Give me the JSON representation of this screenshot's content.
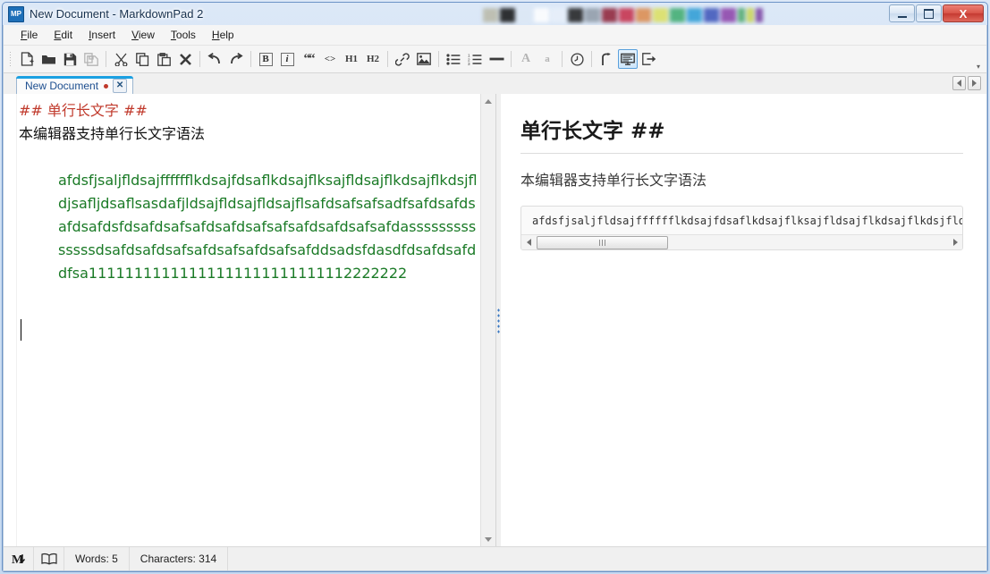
{
  "window": {
    "title": "New Document - MarkdownPad 2",
    "app_icon_label": "MP",
    "buttons": {
      "minimize": "Minimize",
      "maximize": "Maximize",
      "close": "X"
    }
  },
  "menubar": {
    "items": [
      {
        "label": "File",
        "accel": "F"
      },
      {
        "label": "Edit",
        "accel": "E"
      },
      {
        "label": "Insert",
        "accel": "I"
      },
      {
        "label": "View",
        "accel": "V"
      },
      {
        "label": "Tools",
        "accel": "T"
      },
      {
        "label": "Help",
        "accel": "H"
      }
    ]
  },
  "toolbar": {
    "items": [
      {
        "name": "new-document-icon",
        "label": "New",
        "kind": "icon"
      },
      {
        "name": "open-folder-icon",
        "label": "Open",
        "kind": "icon"
      },
      {
        "name": "save-icon",
        "label": "Save",
        "kind": "icon"
      },
      {
        "name": "save-all-icon",
        "label": "Save All",
        "kind": "icon",
        "dim": true
      },
      {
        "name": "separator",
        "label": "",
        "kind": "sep"
      },
      {
        "name": "cut-scissors-icon",
        "label": "Cut",
        "kind": "icon"
      },
      {
        "name": "copy-icon",
        "label": "Copy",
        "kind": "icon"
      },
      {
        "name": "paste-icon",
        "label": "Paste",
        "kind": "icon"
      },
      {
        "name": "delete-x-icon",
        "label": "Delete",
        "kind": "icon"
      },
      {
        "name": "separator",
        "label": "",
        "kind": "sep"
      },
      {
        "name": "undo-icon",
        "label": "Undo",
        "kind": "icon"
      },
      {
        "name": "redo-icon",
        "label": "Redo",
        "kind": "icon"
      },
      {
        "name": "separator",
        "label": "",
        "kind": "sep"
      },
      {
        "name": "bold-icon",
        "label": "B",
        "kind": "boxed"
      },
      {
        "name": "italic-icon",
        "label": "i",
        "kind": "boxed"
      },
      {
        "name": "blockquote-icon",
        "label": "““",
        "kind": "text"
      },
      {
        "name": "inline-code-icon",
        "label": "<>",
        "kind": "text"
      },
      {
        "name": "heading-1-icon",
        "label": "H1",
        "kind": "text"
      },
      {
        "name": "heading-2-icon",
        "label": "H2",
        "kind": "text"
      },
      {
        "name": "separator",
        "label": "",
        "kind": "sep"
      },
      {
        "name": "link-icon",
        "label": "Link",
        "kind": "icon"
      },
      {
        "name": "image-icon",
        "label": "Image",
        "kind": "icon"
      },
      {
        "name": "separator",
        "label": "",
        "kind": "sep"
      },
      {
        "name": "bulleted-list-icon",
        "label": "Bullets",
        "kind": "icon"
      },
      {
        "name": "numbered-list-icon",
        "label": "Numbering",
        "kind": "icon"
      },
      {
        "name": "horizontal-rule-icon",
        "label": "Rule",
        "kind": "icon"
      },
      {
        "name": "separator",
        "label": "",
        "kind": "sep"
      },
      {
        "name": "increase-font-icon",
        "label": "A",
        "kind": "text",
        "dim": true
      },
      {
        "name": "decrease-font-icon",
        "label": "a",
        "kind": "text",
        "dim": true
      },
      {
        "name": "separator",
        "label": "",
        "kind": "sep"
      },
      {
        "name": "timestamp-clock-icon",
        "label": "Timestamp",
        "kind": "icon"
      },
      {
        "name": "separator",
        "label": "",
        "kind": "sep"
      },
      {
        "name": "line-break-icon",
        "label": "Line Break",
        "kind": "icon"
      },
      {
        "name": "live-preview-icon",
        "label": "Live Preview",
        "kind": "icon",
        "selected": true
      },
      {
        "name": "export-icon",
        "label": "Export",
        "kind": "icon"
      }
    ],
    "overflow_label": "▾"
  },
  "tabs": {
    "items": [
      {
        "label": "New Document",
        "modified": true,
        "close_label": "✕"
      }
    ],
    "nav_prev_label": "◄",
    "nav_next_label": "►"
  },
  "editor": {
    "lines": [
      {
        "style": "heading",
        "text": "## 单行长文字 ##"
      },
      {
        "style": "paragraph",
        "text": "本编辑器支持单行长文字语法"
      },
      {
        "style": "blank",
        "text": ""
      },
      {
        "style": "code",
        "text": "afdsfjsaljfldsajfffffflkdsajfdsaflkdsajflksajfldsajflkdsajflkdsjfldjsafljdsaflsasdafjldsajfldsajfldsajflsafdsafsafsadfsafdsafdsafdsafdsfdsafdsafsafdsafdsafsafsafdsafdsafsafdassssssssssssssdsafdsafdsafsafdsafsafdsafsafddsadsfdasdfdsafdsafddfsa11111111111111111111111111112222222"
      }
    ]
  },
  "preview": {
    "heading_text": "单行长文字 ",
    "heading_hashes": "##",
    "paragraph": "本编辑器支持单行长文字语法",
    "code_block": "afdsfjsaljfldsajfffffflkdsajfdsaflkdsajflksajfldsajflkdsajflkdsjfldjsafljdsaflsasdafjldsajfldsajfldsajflsafdsafsafsadfsafdsafdsafdsafdsfdsafdsafsafdsafdsafsafsafdsafdsafsafdass",
    "scroll_left_label": "◄",
    "scroll_right_label": "►"
  },
  "statusbar": {
    "markdown_icon_label": "M",
    "preview_icon_label": "book-icon",
    "words": "Words: 5",
    "characters": "Characters: 314"
  },
  "colors": {
    "accent_tab": "#1ba1e2",
    "heading_red": "#c0392b",
    "code_green": "#1a7a26",
    "title_text": "#16304d",
    "close_button": "#c53a31"
  },
  "desktop_swatches": [
    "#b9b9a8",
    "#111111",
    "#dde8f5",
    "#ffffff",
    "#e8f0fa",
    "#1c1c1c",
    "#8f9aa6",
    "#8e1f33",
    "#c62b46",
    "#dd8a4a",
    "#dde05e",
    "#3cab6d",
    "#2a9bd4",
    "#3b52b8",
    "#8b3fa8",
    "#4ea86a",
    "#c9d44e",
    "#7a3fa0"
  ]
}
